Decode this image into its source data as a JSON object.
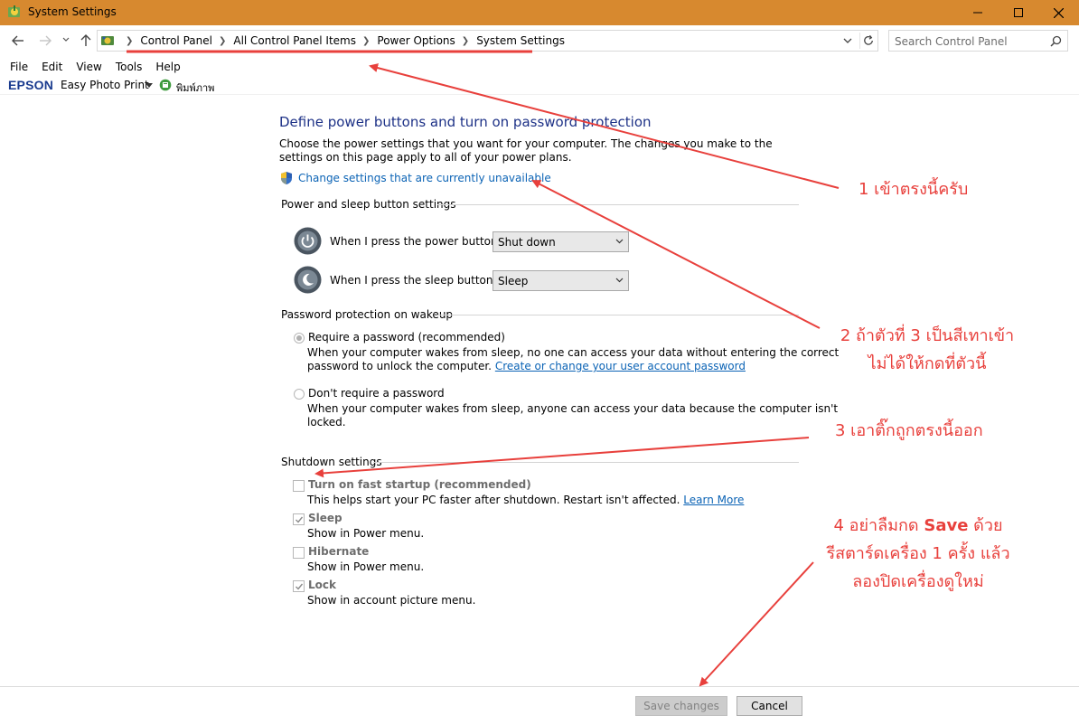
{
  "window": {
    "title": "System Settings",
    "colors": {
      "titlebar": "#d7892f",
      "accent_link": "#0b63b5",
      "heading": "#1e3287",
      "annotation": "#e8403c"
    }
  },
  "address_bar": {
    "breadcrumbs": [
      "Control Panel",
      "All Control Panel Items",
      "Power Options",
      "System Settings"
    ],
    "search_placeholder": "Search Control Panel"
  },
  "menu": [
    "File",
    "Edit",
    "View",
    "Tools",
    "Help"
  ],
  "toolbar": {
    "brand": "EPSON",
    "easy_photo_print": "Easy Photo Print",
    "thai_print": "พิมพ์ภาพ"
  },
  "main": {
    "heading": "Define power buttons and turn on password protection",
    "intro": "Choose the power settings that you want for your computer. The changes you make to the settings on this page apply to all of your power plans.",
    "change_settings_link": "Change settings that are currently unavailable",
    "power_sleep": {
      "title": "Power and sleep button settings",
      "power_button_label": "When I press the power button:",
      "power_button_value": "Shut down",
      "sleep_button_label": "When I press the sleep button:",
      "sleep_button_value": "Sleep"
    },
    "password": {
      "title": "Password protection on wakeup",
      "require_label": "Require a password (recommended)",
      "require_desc_1": "When your computer wakes from sleep, no one can access your data without entering the correct",
      "require_desc_2": "password to unlock the computer.",
      "require_link": "Create or change your user account password",
      "norequire_label": "Don't require a password",
      "norequire_desc_1": "When your computer wakes from sleep, anyone can access your data because the computer isn't",
      "norequire_desc_2": "locked."
    },
    "shutdown": {
      "title": "Shutdown settings",
      "fast_startup_label": "Turn on fast startup (recommended)",
      "fast_startup_desc": "This helps start your PC faster after shutdown. Restart isn't affected.",
      "learn_more": "Learn More",
      "sleep_label": "Sleep",
      "sleep_desc": "Show in Power menu.",
      "hibernate_label": "Hibernate",
      "hibernate_desc": "Show in Power menu.",
      "lock_label": "Lock",
      "lock_desc": "Show in account picture menu."
    }
  },
  "buttons": {
    "save": "Save changes",
    "cancel": "Cancel"
  },
  "annotations": {
    "a1": "1 เข้าตรงนี้ครับ",
    "a2_line1": "2 ถ้าตัวที่ 3 เป็นสีเทาเข้า",
    "a2_line2": "ไม่ได้ให้กดที่ตัวนี้",
    "a3": "3 เอาติ๊กถูกตรงนี้ออก",
    "a4_line1_pre": "4 อย่าลืมกด",
    "a4_line1_bold": "Save",
    "a4_line1_post": "ด้วย",
    "a4_line2": "รีสตาร์ดเครื่อง 1 ครั้ง แล้ว",
    "a4_line3": "ลองปิดเครื่องดูใหม่"
  }
}
